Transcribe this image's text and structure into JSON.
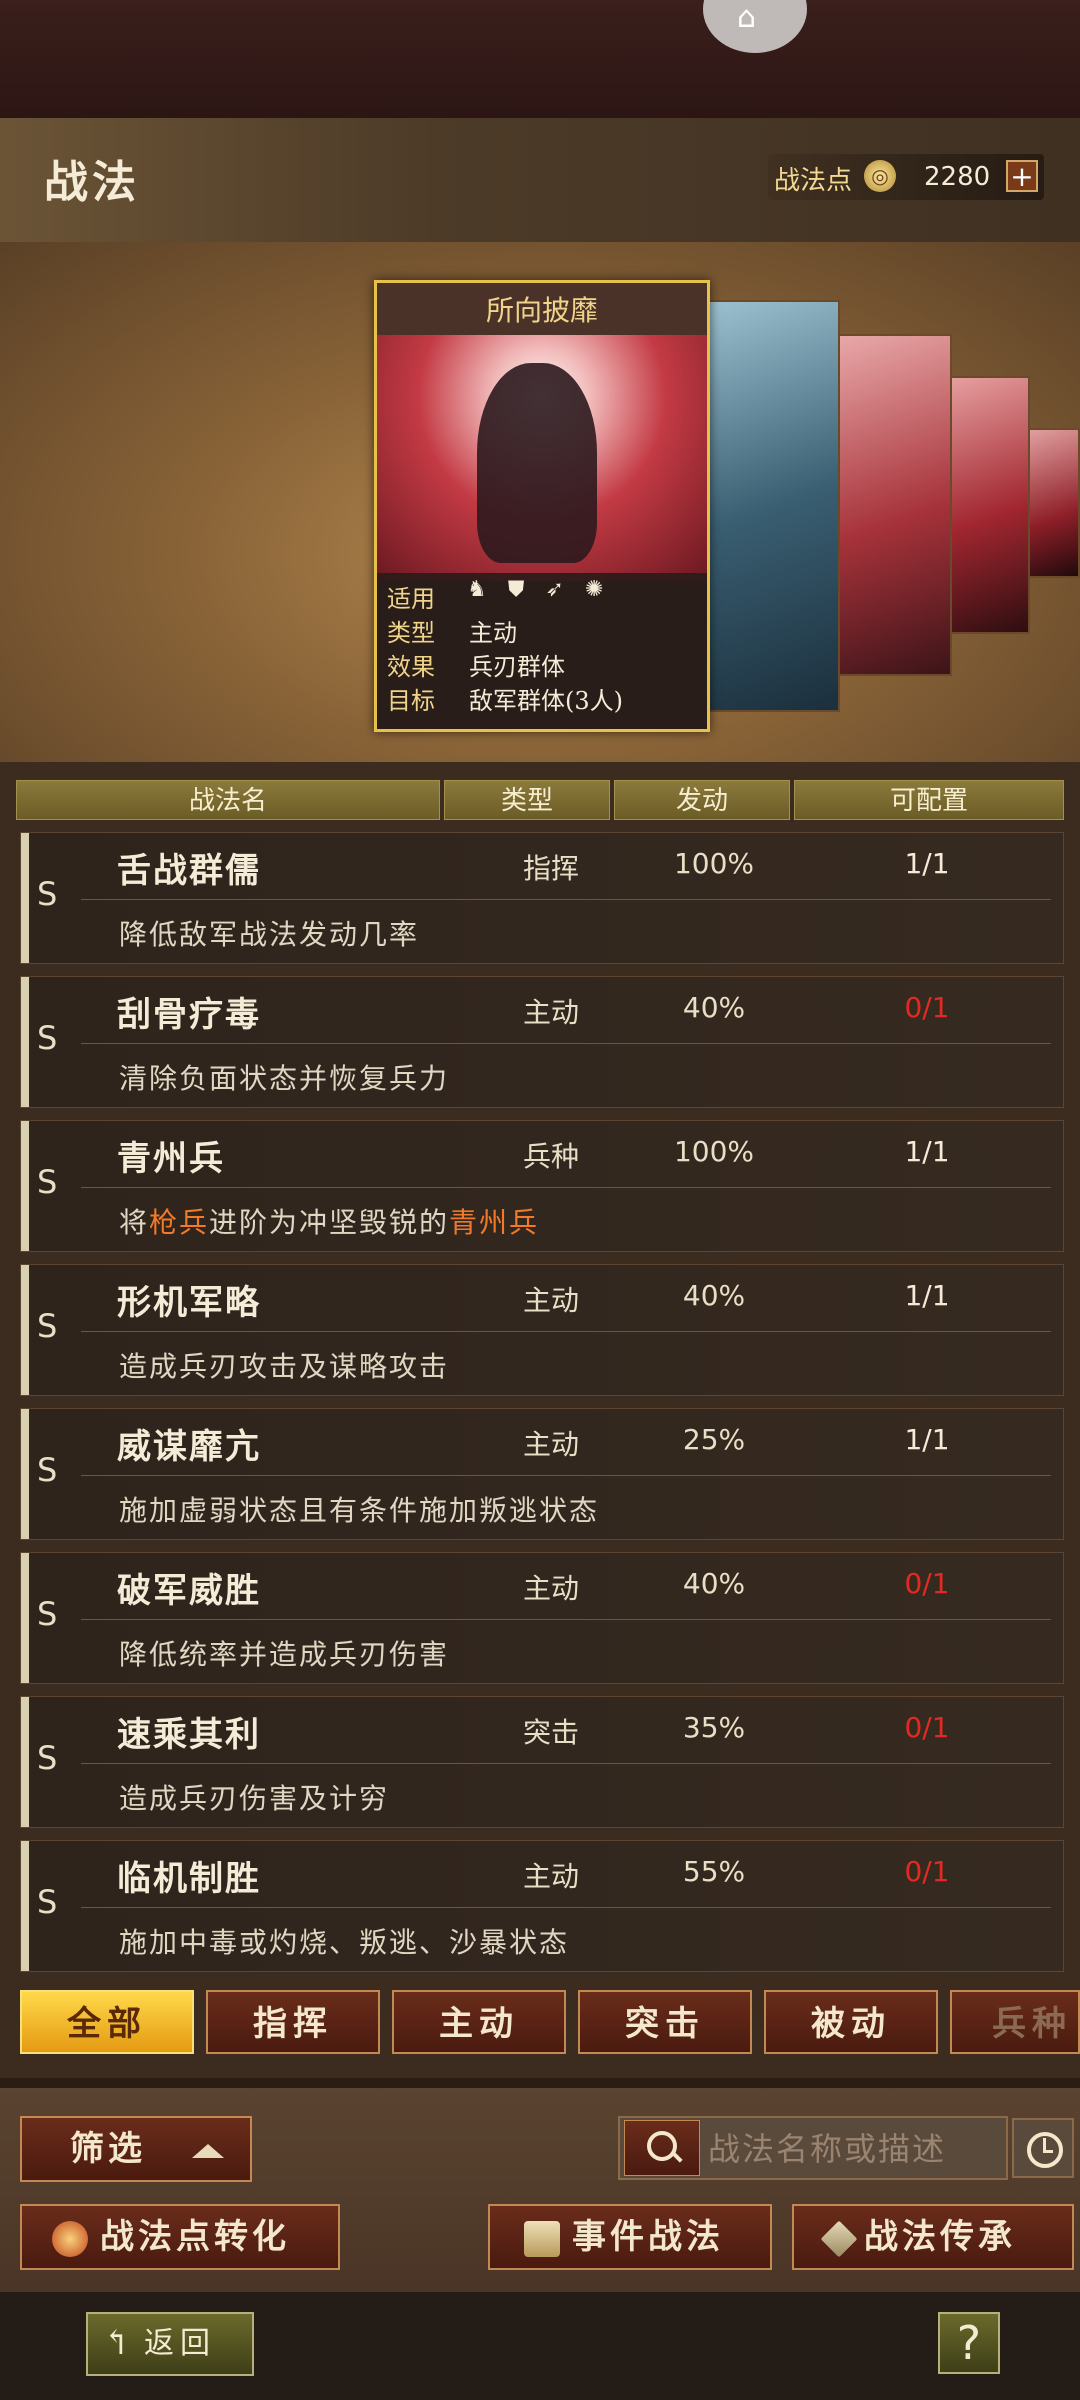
{
  "header": {
    "title": "战法",
    "points_label": "战法点",
    "points_value": "2280",
    "plus": "+"
  },
  "card": {
    "title": "所向披靡",
    "rows": [
      {
        "key": "适用",
        "value": ""
      },
      {
        "key": "类型",
        "value": "主动"
      },
      {
        "key": "效果",
        "value": "兵刃群体"
      },
      {
        "key": "目标",
        "value": "敌军群体(3人)"
      }
    ],
    "unit_icons": [
      "cavalry-icon",
      "shield-icon",
      "bow-icon",
      "chariot-icon"
    ]
  },
  "columns": {
    "name": "战法名",
    "type": "类型",
    "rate": "发动",
    "config": "可配置"
  },
  "tactics": [
    {
      "grade": "S",
      "name": "舌战群儒",
      "type": "指挥",
      "rate": "100%",
      "config": "1/1",
      "config_red": false,
      "desc": "降低敌军战法发动几率"
    },
    {
      "grade": "S",
      "name": "刮骨疗毒",
      "type": "主动",
      "rate": "40%",
      "config": "0/1",
      "config_red": true,
      "desc": "清除负面状态并恢复兵力"
    },
    {
      "grade": "S",
      "name": "青州兵",
      "type": "兵种",
      "rate": "100%",
      "config": "1/1",
      "config_red": false,
      "desc_parts": [
        "将",
        "枪兵",
        "进阶为冲坚毁锐的",
        "青州兵"
      ]
    },
    {
      "grade": "S",
      "name": "形机军略",
      "type": "主动",
      "rate": "40%",
      "config": "1/1",
      "config_red": false,
      "desc": "造成兵刃攻击及谋略攻击"
    },
    {
      "grade": "S",
      "name": "威谋靡亢",
      "type": "主动",
      "rate": "25%",
      "config": "1/1",
      "config_red": false,
      "desc": "施加虚弱状态且有条件施加叛逃状态"
    },
    {
      "grade": "S",
      "name": "破军威胜",
      "type": "主动",
      "rate": "40%",
      "config": "0/1",
      "config_red": true,
      "desc": "降低统率并造成兵刃伤害"
    },
    {
      "grade": "S",
      "name": "速乘其利",
      "type": "突击",
      "rate": "35%",
      "config": "0/1",
      "config_red": true,
      "desc": "造成兵刃伤害及计穷"
    },
    {
      "grade": "S",
      "name": "临机制胜",
      "type": "主动",
      "rate": "55%",
      "config": "0/1",
      "config_red": true,
      "desc": "施加中毒或灼烧、叛逃、沙暴状态"
    }
  ],
  "tabs": [
    "全部",
    "指挥",
    "主动",
    "突击",
    "被动",
    "兵种"
  ],
  "controls": {
    "filter": "筛选",
    "search_placeholder": "战法名称或描述",
    "convert": "战法点转化",
    "event": "事件战法",
    "inherit": "战法传承"
  },
  "footer": {
    "back": "返回",
    "help": "?"
  },
  "colors": {
    "accent_gold": "#e7c24a",
    "red": "#e22a22",
    "highlight": "#f07a2a",
    "tab_active": "#ffd94a"
  }
}
